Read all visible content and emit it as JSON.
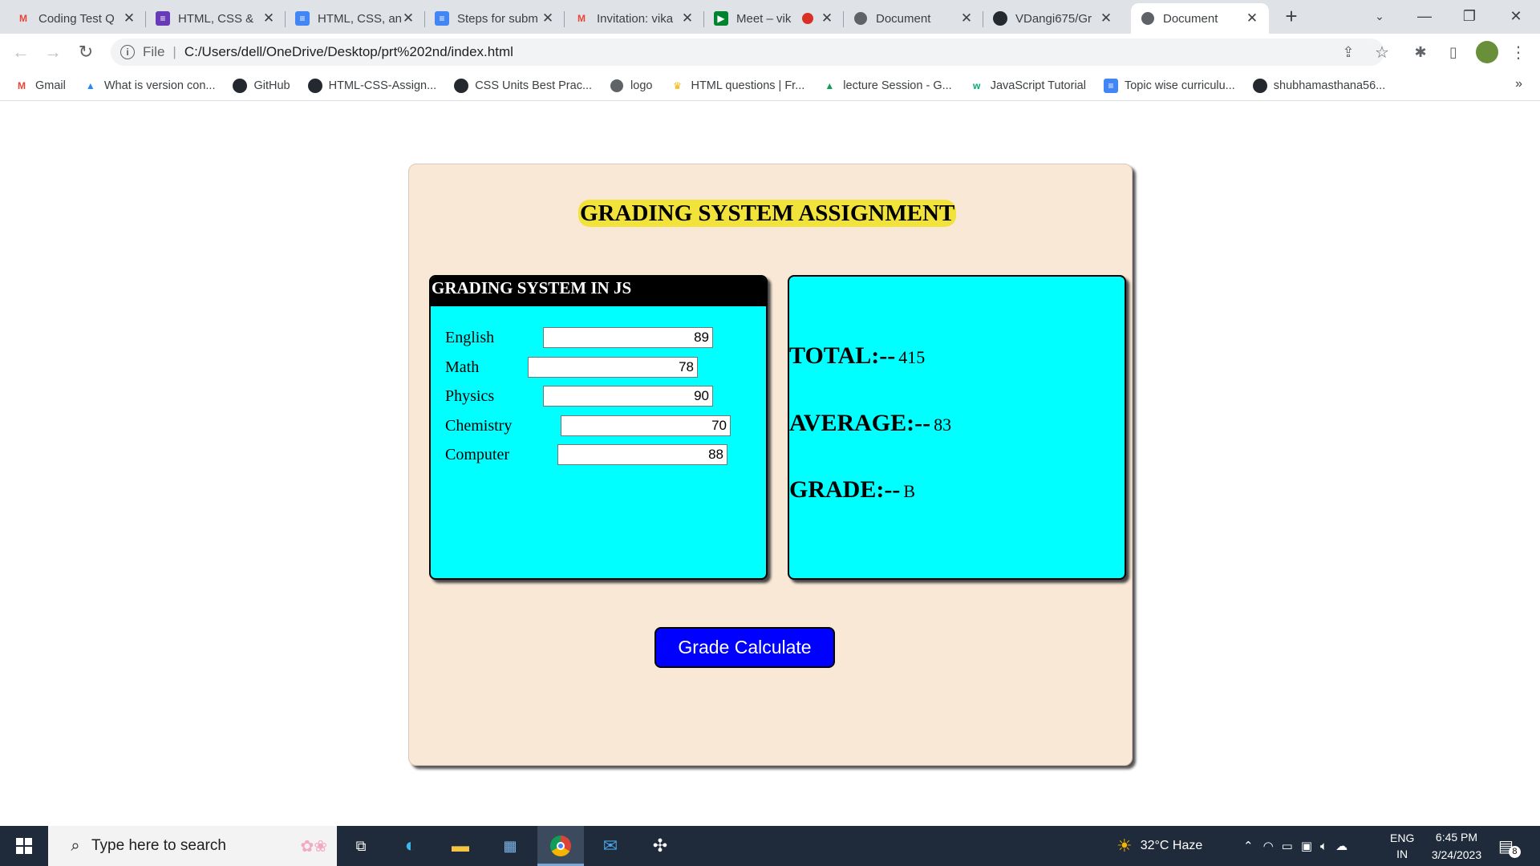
{
  "browser": {
    "tabs": [
      {
        "title": "Coding Test Q",
        "icon": "gmail-icon"
      },
      {
        "title": "HTML, CSS &",
        "icon": "forms-icon"
      },
      {
        "title": "HTML, CSS, an",
        "icon": "docs-icon"
      },
      {
        "title": "Steps for subm",
        "icon": "docs-icon"
      },
      {
        "title": "Invitation: vika",
        "icon": "gmail-icon"
      },
      {
        "title": "Meet – vik",
        "icon": "meet-icon"
      },
      {
        "title": "Document",
        "icon": "globe-icon"
      },
      {
        "title": "VDangi675/Gr",
        "icon": "github-icon"
      },
      {
        "title": "Document",
        "icon": "globe-icon",
        "active": true
      }
    ],
    "new_tab": "+",
    "address": {
      "scheme_label": "File",
      "url": "C:/Users/dell/OneDrive/Desktop/prt%202nd/index.html"
    },
    "bookmarks": [
      {
        "label": "Gmail",
        "icon": "gmail-icon"
      },
      {
        "label": "What is version con...",
        "icon": "atlassian-icon"
      },
      {
        "label": "GitHub",
        "icon": "github-icon"
      },
      {
        "label": "HTML-CSS-Assign...",
        "icon": "github-icon"
      },
      {
        "label": "CSS Units Best Prac...",
        "icon": "github-icon"
      },
      {
        "label": "logo",
        "icon": "globe-icon"
      },
      {
        "label": "HTML questions | Fr...",
        "icon": "trophy-icon"
      },
      {
        "label": "lecture Session - G...",
        "icon": "drive-icon"
      },
      {
        "label": "JavaScript Tutorial",
        "icon": "w3-icon"
      },
      {
        "label": "Topic wise curriculu...",
        "icon": "docs-icon"
      },
      {
        "label": "shubhamasthana56...",
        "icon": "github-icon"
      }
    ],
    "bookmarks_overflow": "»"
  },
  "app": {
    "title": "GRADING SYSTEM ASSIGNMENT",
    "input_panel_heading": "GRADING SYSTEM IN JS",
    "subjects": [
      {
        "label": "English",
        "value": "89"
      },
      {
        "label": "Math",
        "value": "78"
      },
      {
        "label": "Physics",
        "value": "90"
      },
      {
        "label": "Chemistry",
        "value": "70"
      },
      {
        "label": "Computer",
        "value": "88"
      }
    ],
    "results": {
      "total_label": "TOTAL:--",
      "total_value": "415",
      "average_label": "AVERAGE:--",
      "average_value": "83",
      "grade_label": "GRADE:--",
      "grade_value": "B"
    },
    "button_label": "Grade Calculate",
    "colors": {
      "container_bg": "#f9e8d6",
      "panel_bg": "#00ffff",
      "title_highlight": "#f2e33a",
      "button_bg": "#0000ff"
    }
  },
  "taskbar": {
    "search_placeholder": "Type here to search",
    "weather": "32°C  Haze",
    "language_top": "ENG",
    "language_bottom": "IN",
    "time": "6:45 PM",
    "date": "3/24/2023",
    "notification_count": "8"
  }
}
